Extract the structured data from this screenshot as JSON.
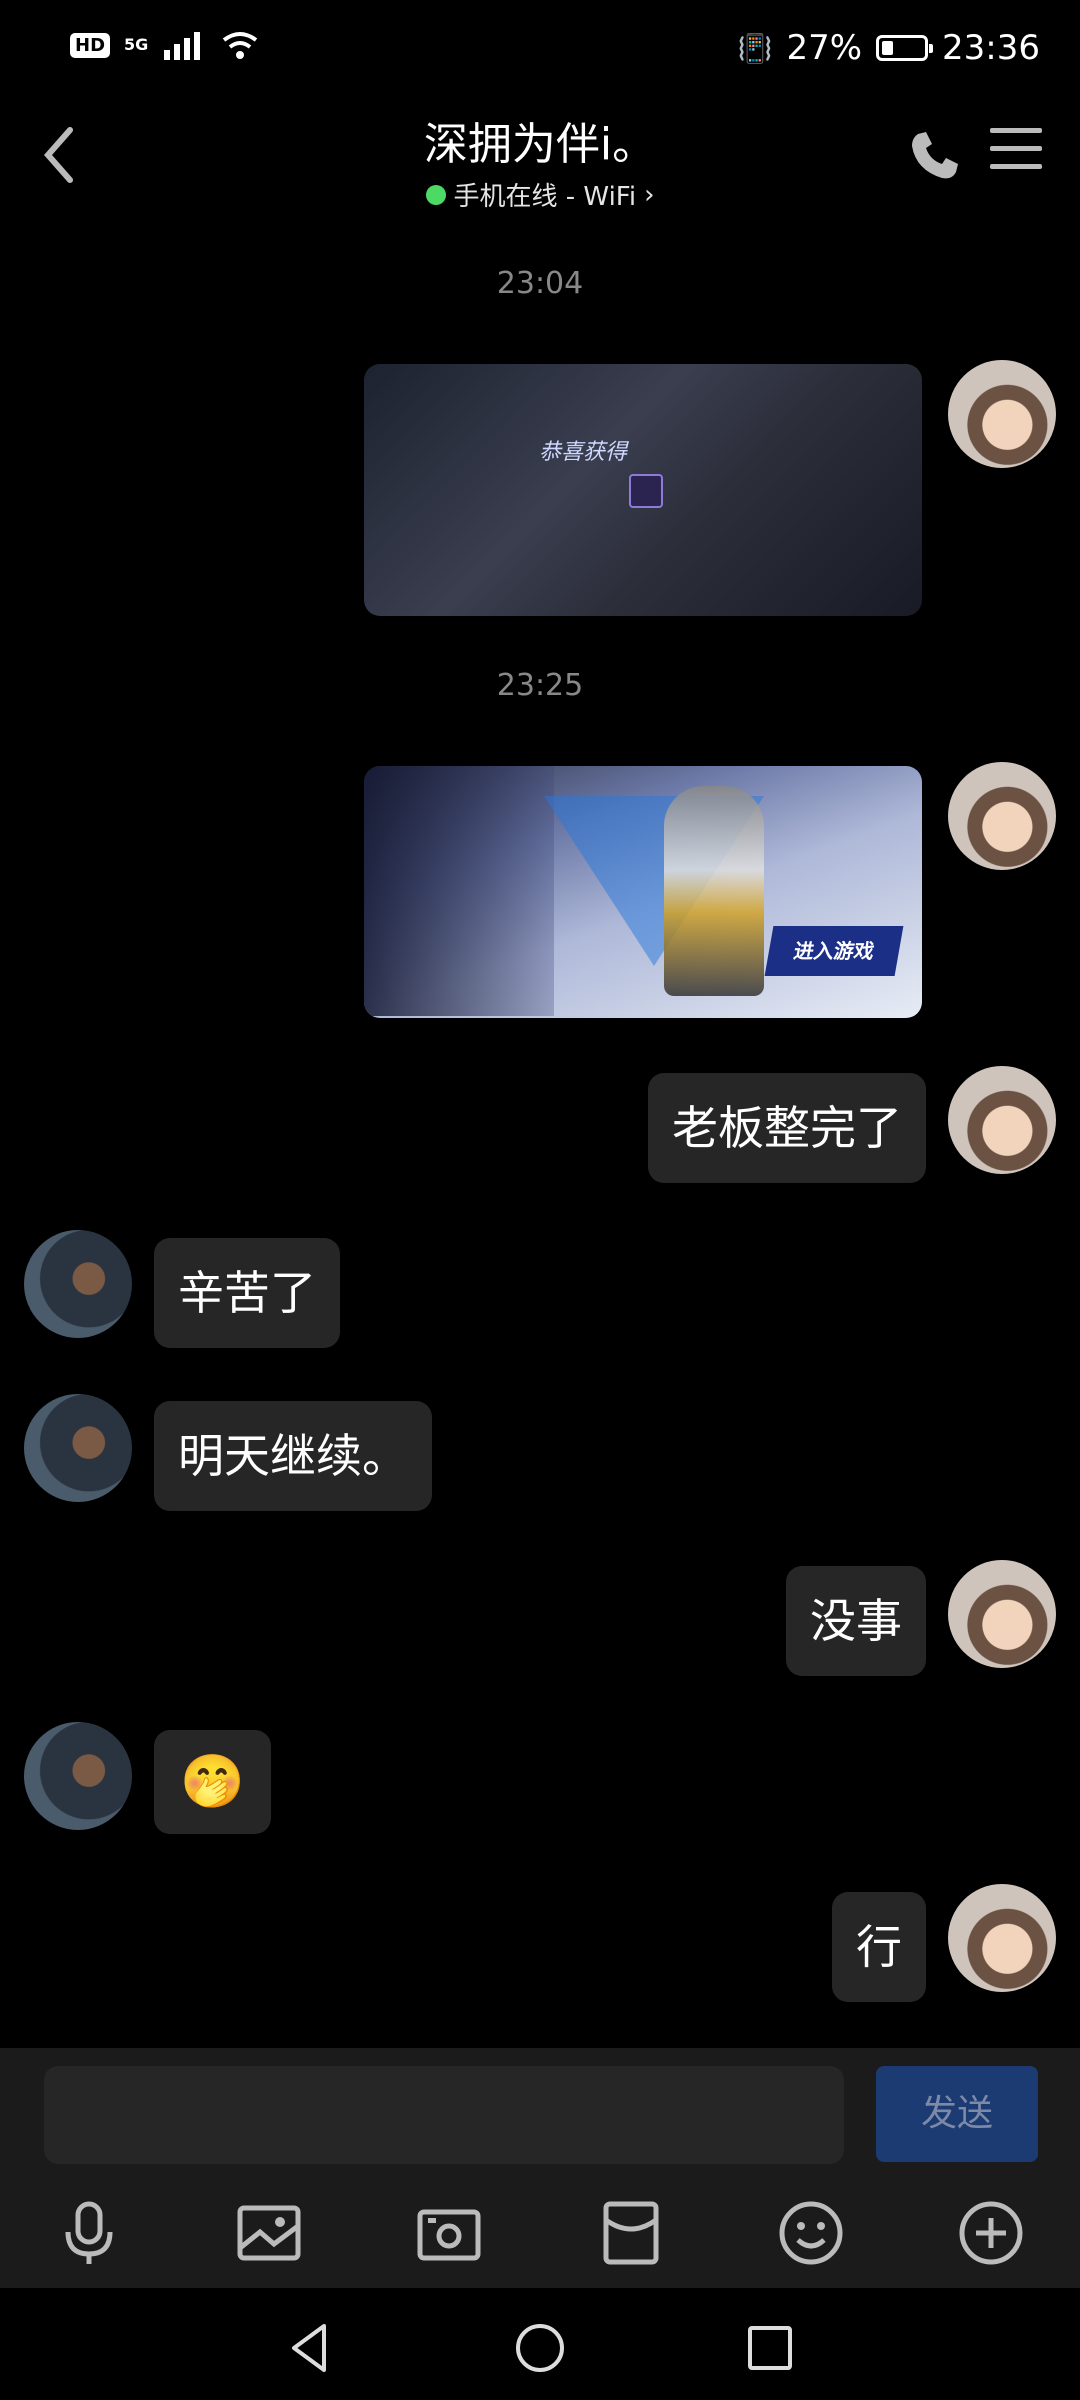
{
  "status_bar": {
    "hd": "HD",
    "network": "5G",
    "battery_percent": "27%",
    "time": "23:36",
    "battery_level": 0.27
  },
  "header": {
    "title": "深拥为伴i。",
    "subtitle": "手机在线 - WiFi",
    "online_color": "#4cd964"
  },
  "messages": {
    "ts1": "23:04",
    "ts2": "23:25",
    "m1": "老板整完了",
    "m2": "辛苦了",
    "m3": "明天继续。",
    "m4": "没事",
    "m5": "🤭",
    "m6": "行",
    "img1_caption": "恭喜获得",
    "img2_enter": "进入游戏"
  },
  "input": {
    "placeholder": "",
    "send_label": "发送"
  },
  "toolbar": {
    "icons": [
      "microphone-icon",
      "image-icon",
      "camera-icon",
      "red-packet-icon",
      "emoji-icon",
      "plus-icon"
    ]
  },
  "colors": {
    "background": "#000000",
    "bubble": "#262626",
    "send_button": "#1d3b73"
  }
}
